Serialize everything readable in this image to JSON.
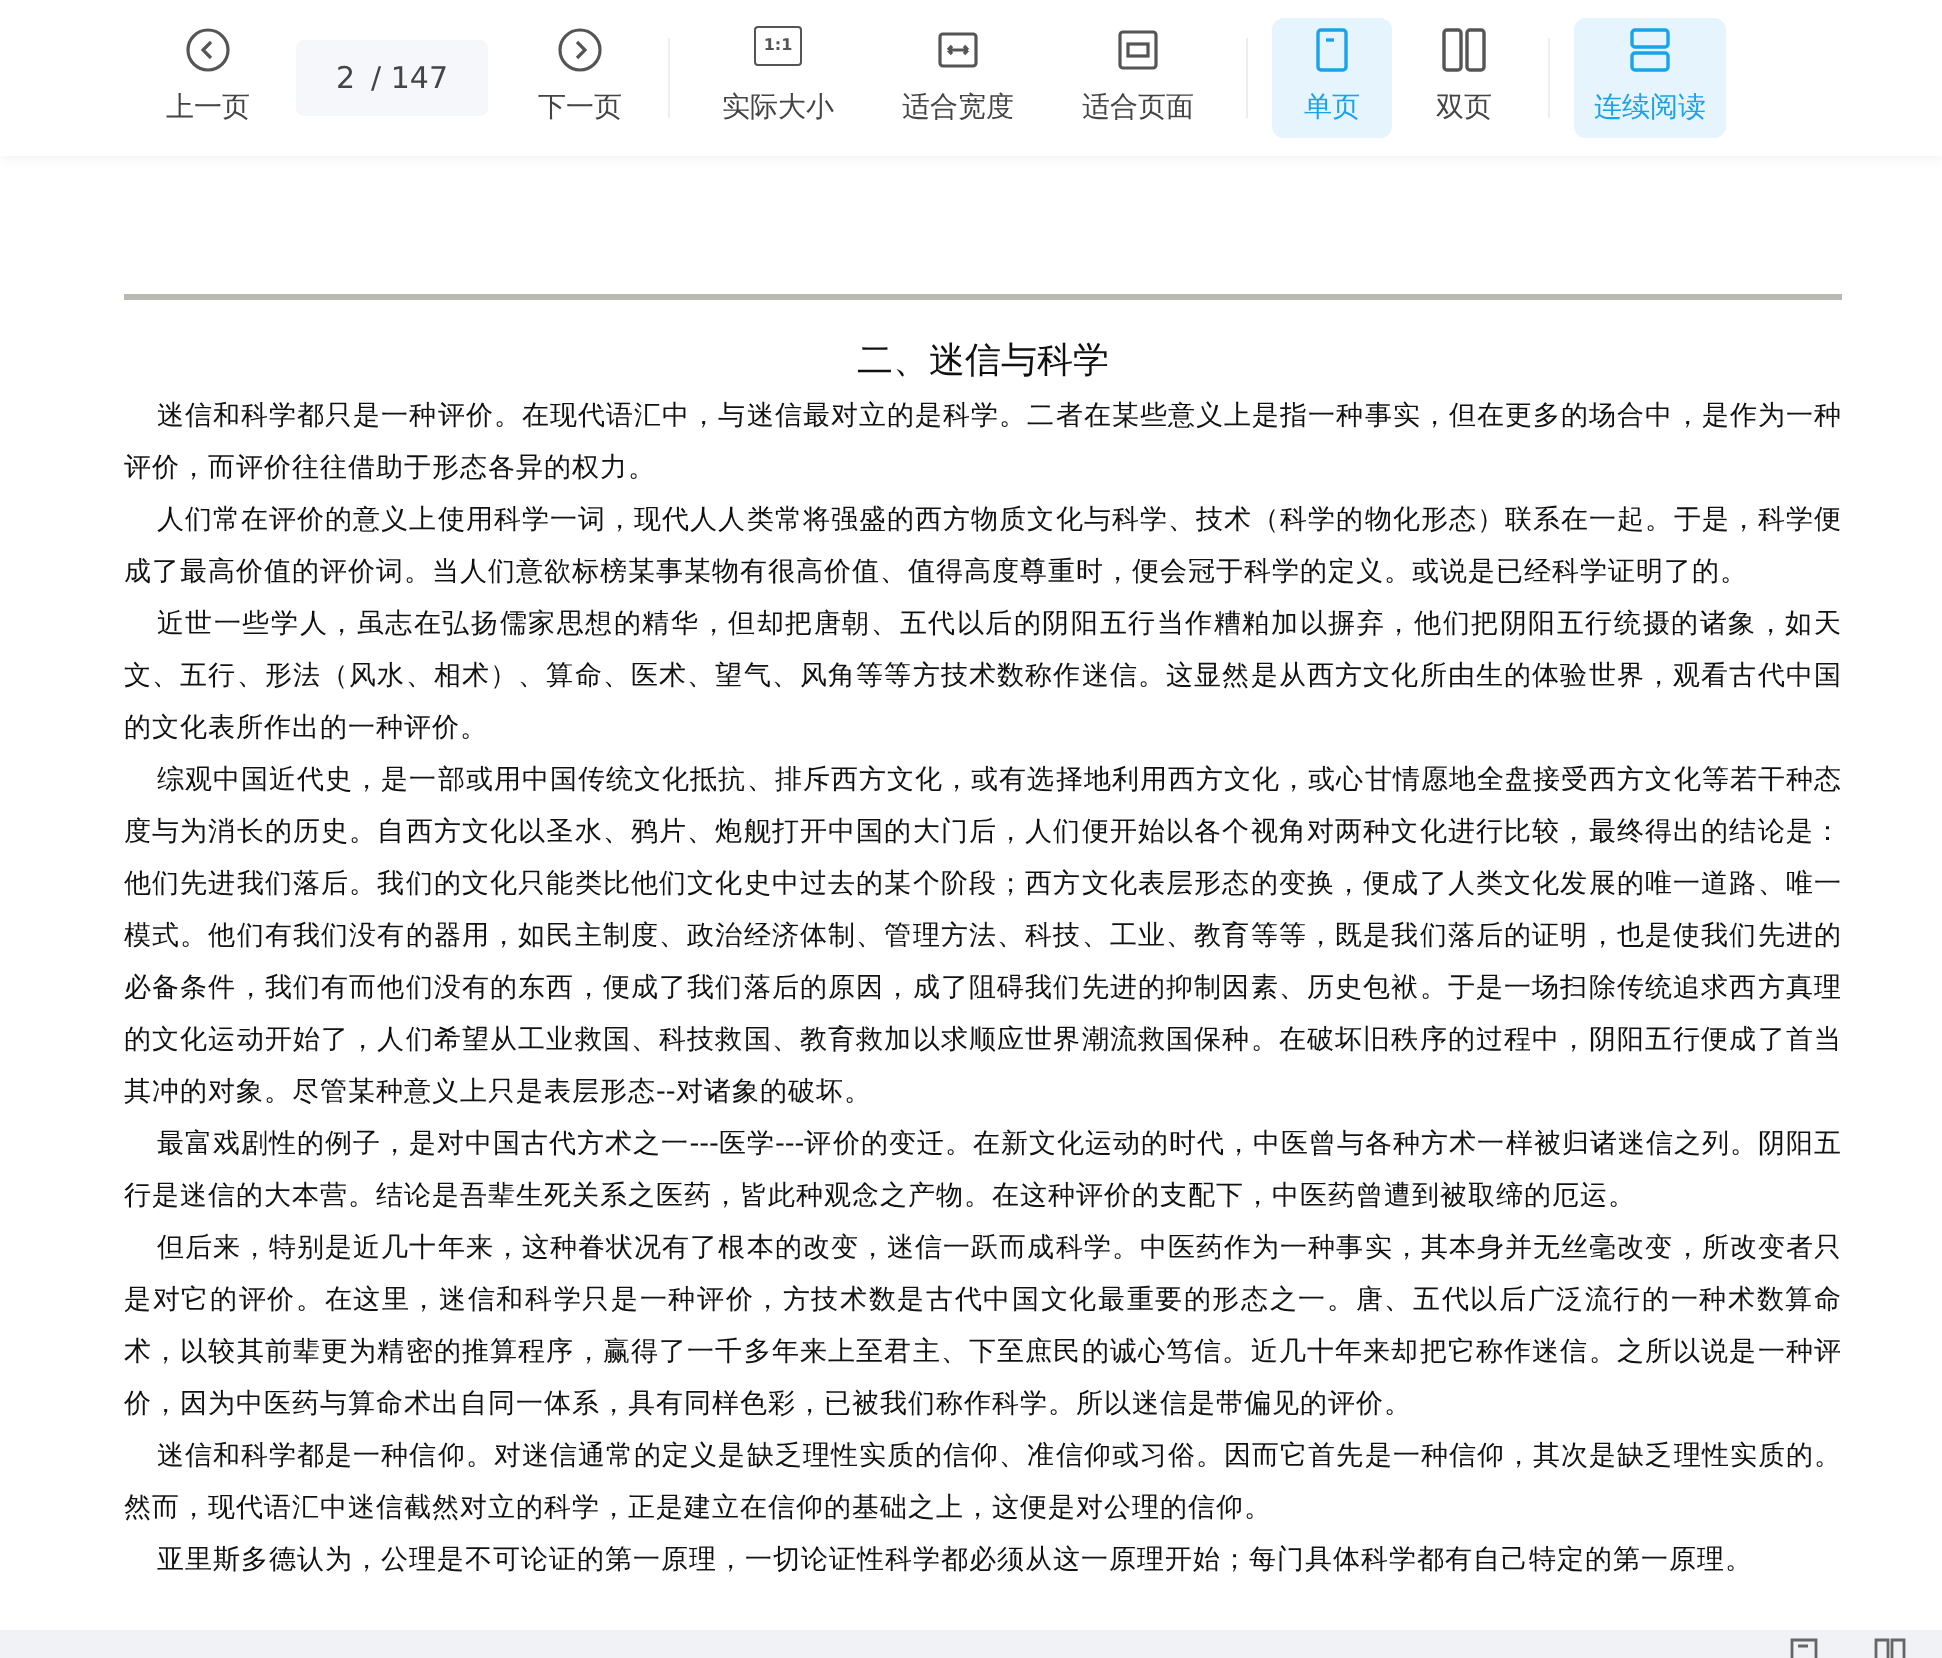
{
  "toolbar": {
    "prev": {
      "label": "上一页"
    },
    "page_field": {
      "value": "2",
      "total": "/ 147"
    },
    "next": {
      "label": "下一页"
    },
    "zoom_buttons": [
      {
        "kind": "actual",
        "label": "实际大小",
        "icon_text": "1:1"
      },
      {
        "kind": "width",
        "label": "适合宽度"
      },
      {
        "kind": "page",
        "label": "适合页面"
      }
    ],
    "page_modes": [
      {
        "kind": "single",
        "label": "单页",
        "selected": true
      },
      {
        "kind": "double",
        "label": "双页",
        "selected": false
      }
    ],
    "continuous": {
      "label": "连续阅读",
      "on": true
    }
  },
  "document": {
    "heading": "二、迷信与科学",
    "paragraphs": [
      "迷信和科学都只是一种评价。在现代语汇中，与迷信最对立的是科学。二者在某些意义上是指一种事实，但在更多的场合中，是作为一种评价，而评价往往借助于形态各异的权力。",
      "人们常在评价的意义上使用科学一词，现代人人类常将强盛的西方物质文化与科学、技术（科学的物化形态）联系在一起。于是，科学便成了最高价值的评价词。当人们意欲标榜某事某物有很高价值、值得高度尊重时，便会冠于科学的定义。或说是已经科学证明了的。",
      "近世一些学人，虽志在弘扬儒家思想的精华，但却把唐朝、五代以后的阴阳五行当作糟粕加以摒弃，他们把阴阳五行统摄的诸象，如天文、五行、形法（风水、相术）、算命、医术、望气、风角等等方技术数称作迷信。这显然是从西方文化所由生的体验世界，观看古代中国的文化表所作出的一种评价。",
      "综观中国近代史，是一部或用中国传统文化抵抗、排斥西方文化，或有选择地利用西方文化，或心甘情愿地全盘接受西方文化等若干种态度与为消长的历史。自西方文化以圣水、鸦片、炮舰打开中国的大门后，人们便开始以各个视角对两种文化进行比较，最终得出的结论是：他们先进我们落后。我们的文化只能类比他们文化史中过去的某个阶段；西方文化表层形态的变换，便成了人类文化发展的唯一道路、唯一模式。他们有我们没有的器用，如民主制度、政治经济体制、管理方法、科技、工业、教育等等，既是我们落后的证明，也是使我们先进的必备条件，我们有而他们没有的东西，便成了我们落后的原因，成了阻碍我们先进的抑制因素、历史包袱。于是一场扫除传统追求西方真理的文化运动开始了，人们希望从工业救国、科技救国、教育救加以求顺应世界潮流救国保种。在破坏旧秩序的过程中，阴阳五行便成了首当其冲的对象。尽管某种意义上只是表层形态--对诸象的破坏。",
      "最富戏剧性的例子，是对中国古代方术之一---医学---评价的变迁。在新文化运动的时代，中医曾与各种方术一样被归诸迷信之列。阴阳五行是迷信的大本营。结论是吾辈生死关系之医药，皆此种观念之产物。在这种评价的支配下，中医药曾遭到被取缔的厄运。",
      "但后来，特别是近几十年来，这种眷状况有了根本的改变，迷信一跃而成科学。中医药作为一种事实，其本身并无丝毫改变，所改变者只是对它的评价。在这里，迷信和科学只是一种评价，方技术数是古代中国文化最重要的形态之一。唐、五代以后广泛流行的一种术数算命术，以较其前辈更为精密的推算程序，赢得了一千多年来上至君主、下至庶民的诚心笃信。近几十年来却把它称作迷信。之所以说是一种评价，因为中医药与算命术出自同一体系，具有同样色彩，已被我们称作科学。所以迷信是带偏见的评价。",
      "迷信和科学都是一种信仰。对迷信通常的定义是缺乏理性实质的信仰、准信仰或习俗。因而它首先是一种信仰，其次是缺乏理性实质的。然而，现代语汇中迷信截然对立的科学，正是建立在信仰的基础之上，这便是对公理的信仰。",
      "亚里斯多德认为，公理是不可论证的第一原理，一切论证性科学都必须从这一原理开始；每门具体科学都有自己特定的第一原理。"
    ]
  }
}
